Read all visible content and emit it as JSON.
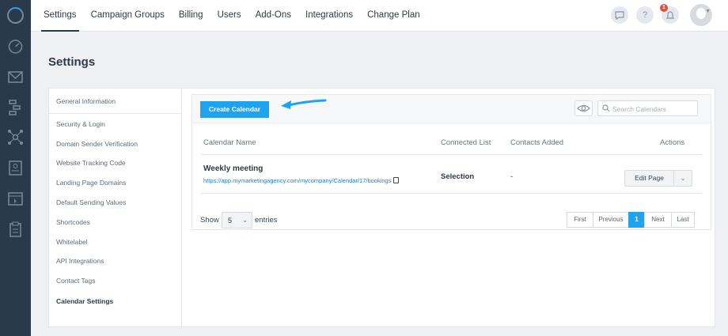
{
  "nav": {
    "items": [
      "Settings",
      "Campaign Groups",
      "Billing",
      "Users",
      "Add-Ons",
      "Integrations",
      "Change Plan"
    ],
    "active_index": 0,
    "notification_count": "1",
    "help_label": "?"
  },
  "page": {
    "title": "Settings"
  },
  "sidebar": {
    "items": [
      "General Information",
      "Security & Login",
      "Domain Sender Verification",
      "Website Tracking Code",
      "Landing Page Domains",
      "Default Sending Values",
      "Shortcodes",
      "Whitelabel",
      "API Integrations",
      "Contact Tags",
      "Calendar Settings"
    ],
    "active_index": 10
  },
  "toolbar": {
    "create_label": "Create Calendar",
    "search_placeholder": "Search Calendars"
  },
  "table": {
    "headers": [
      "Calendar Name",
      "Connected List",
      "Contacts Added",
      "Actions"
    ],
    "rows": [
      {
        "name": "Weekly meeting",
        "link": "https://app.mymarketingagency.com/mycompany/Calendar/17/bookings",
        "connected_list": "Selection",
        "contacts_added": "-",
        "action_label": "Edit Page"
      }
    ]
  },
  "footer": {
    "show_label": "Show",
    "entries_label": "entries",
    "page_size": "5",
    "pager": [
      "First",
      "Previous",
      "1",
      "Next",
      "Last"
    ],
    "current_page": "1"
  },
  "colors": {
    "accent": "#1fa3ec",
    "rail": "#2b3a4a",
    "text_dark": "#2e3a46"
  }
}
